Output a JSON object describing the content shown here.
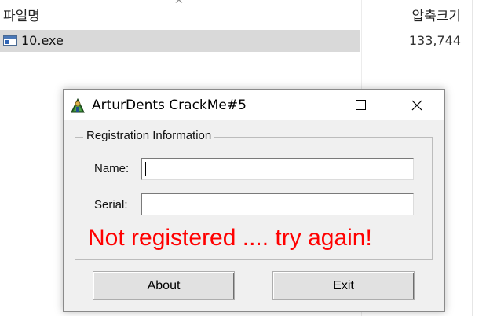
{
  "explorer": {
    "name_header": "파일명",
    "size_header": "압축크기",
    "sort_arrow": "^",
    "files": [
      {
        "name": "10.exe",
        "size": "133,744",
        "icon": "exe-file-icon"
      }
    ]
  },
  "dialog": {
    "title": "ArturDents CrackMe#5",
    "app_icon": "crackme-app-icon",
    "group_title": "Registration Information",
    "name_label": "Name:",
    "name_value": "",
    "serial_label": "Serial:",
    "serial_value": "",
    "status": "Not registered .... try again!",
    "status_color": "#ff0000",
    "about_button": "About",
    "exit_button": "Exit"
  }
}
